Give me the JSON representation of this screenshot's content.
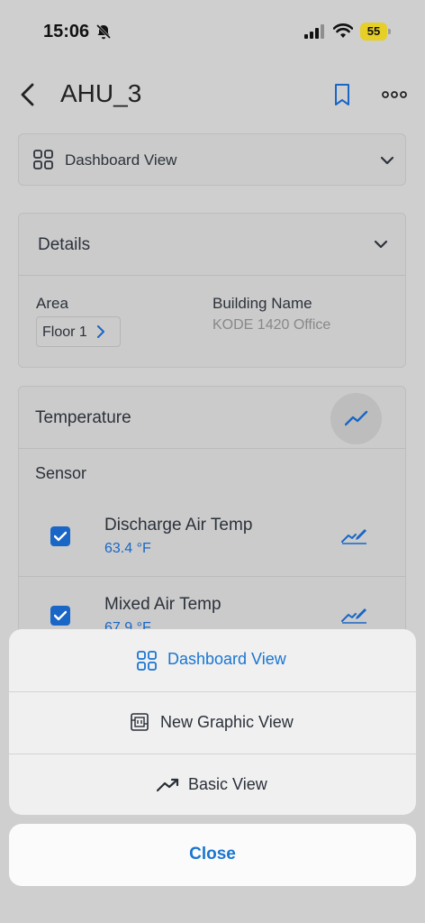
{
  "status": {
    "time": "15:06",
    "battery": "55"
  },
  "header": {
    "title": "AHU_3"
  },
  "view_select": {
    "label": "Dashboard View"
  },
  "details": {
    "title": "Details",
    "area_label": "Area",
    "area_value": "Floor 1",
    "building_label": "Building Name",
    "building_value": "KODE 1420 Office"
  },
  "temperature": {
    "title": "Temperature",
    "sensor_label": "Sensor",
    "sensors": [
      {
        "name": "Discharge Air Temp",
        "value": "63.4 °F"
      },
      {
        "name": "Mixed Air Temp",
        "value": "67.9 °F"
      }
    ]
  },
  "sheet": {
    "options": [
      {
        "label": "Dashboard View",
        "icon": "grid-icon",
        "color": "#1a75d1"
      },
      {
        "label": "New Graphic View",
        "icon": "graphic-view-icon",
        "color": "#2a2f38"
      },
      {
        "label": "Basic View",
        "icon": "trend-icon",
        "color": "#2a2f38"
      }
    ],
    "close_label": "Close"
  },
  "colors": {
    "accent": "#1a75d1",
    "checkbox": "#1a66c6"
  }
}
